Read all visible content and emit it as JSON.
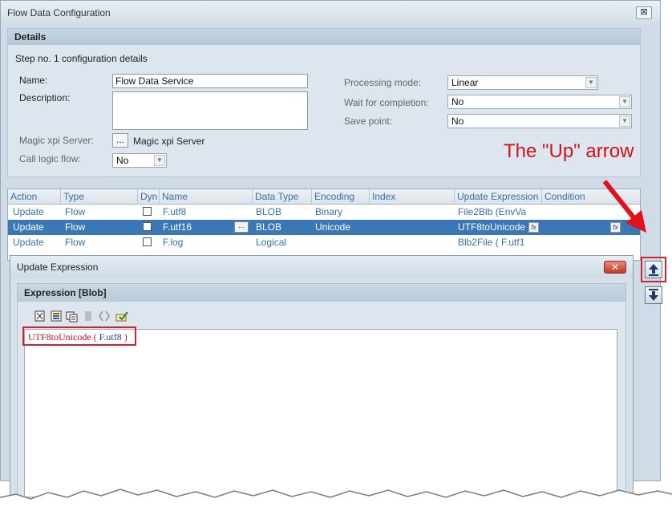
{
  "window": {
    "title": "Flow Data Configuration",
    "close_label": "⊠"
  },
  "details": {
    "header": "Details",
    "step_text": "Step no. 1 configuration details",
    "name_label": "Name:",
    "name_value": "Flow Data Service",
    "description_label": "Description:",
    "description_value": "",
    "server_label": "Magic xpi Server:",
    "server_button": "...",
    "server_value": "Magic xpi Server",
    "call_logic_label": "Call logic flow:",
    "call_logic_value": "No",
    "processing_mode_label": "Processing mode:",
    "processing_mode_value": "Linear",
    "wait_label": "Wait for completion:",
    "wait_value": "No",
    "save_point_label": "Save point:",
    "save_point_value": "No"
  },
  "grid": {
    "columns": [
      "Action",
      "Type",
      "Dyn",
      "Name",
      "Data Type",
      "Encoding",
      "Index",
      "Update Expression",
      "Condition"
    ],
    "rows": [
      {
        "action": "Update",
        "type": "Flow",
        "name": "F.utf8",
        "data_type": "BLOB",
        "encoding": "Binary",
        "update_expr": "File2Blb (EnvVa",
        "selected": false
      },
      {
        "action": "Update",
        "type": "Flow",
        "name": "F.utf16",
        "data_type": "BLOB",
        "encoding": "Unicode",
        "update_expr": "UTF8toUnicode",
        "selected": true
      },
      {
        "action": "Update",
        "type": "Flow",
        "name": "F.log",
        "data_type": "Logical",
        "encoding": "",
        "update_expr": "Blb2File ( F.utf1",
        "selected": false
      }
    ],
    "fx_label": "fx",
    "ellipsis_label": "..."
  },
  "annotation": {
    "text": "The \"Up\" arrow"
  },
  "dialog": {
    "title": "Update Expression",
    "close_label": "✕",
    "panel_header": "Expression [Blob]",
    "expression_func": "UTF8toUnicode (",
    "expression_arg": " F.utf8 ",
    "expression_close": ")"
  },
  "colors": {
    "accent": "#3a77b5",
    "annotation": "#d0101d",
    "highlight": "#d8202a"
  },
  "icons": [
    "clear-icon",
    "functions-icon",
    "variables-icon",
    "disabled-icon",
    "brackets-icon",
    "verify-icon",
    "up-arrow-icon",
    "down-arrow-icon"
  ]
}
